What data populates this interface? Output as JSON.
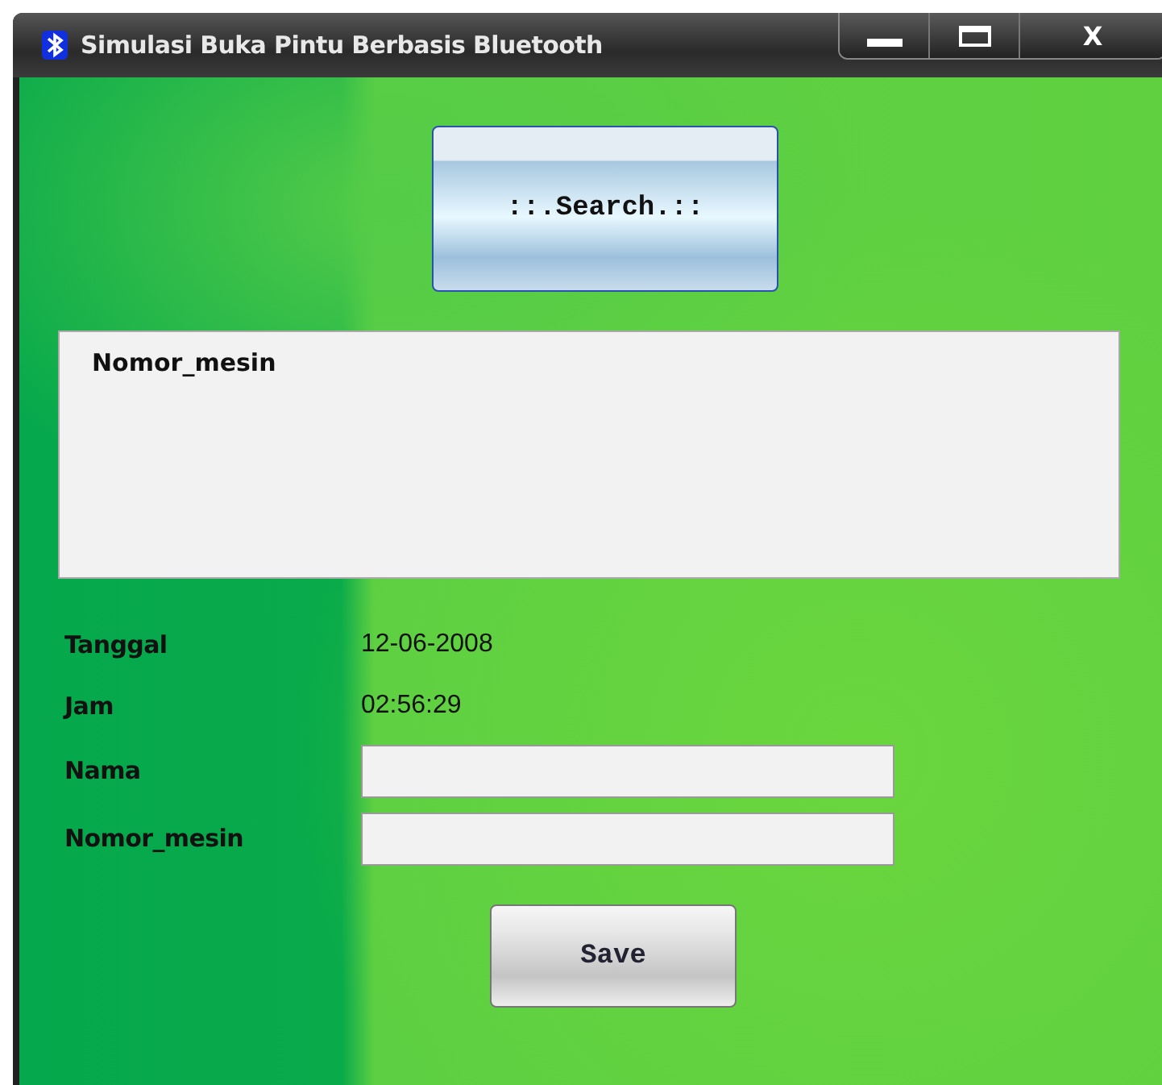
{
  "window": {
    "title": "Simulasi Buka Pintu Berbasis Bluetooth",
    "controls": [
      {
        "kind": "minimize"
      },
      {
        "kind": "maximize"
      },
      {
        "kind": "close",
        "label": "X"
      }
    ]
  },
  "search_button": {
    "label": "::.Search.::"
  },
  "list": {
    "items": [
      "Nomor_mesin"
    ]
  },
  "fields": [
    {
      "kind": "text",
      "label": "Tanggal",
      "value": "12-06-2008"
    },
    {
      "kind": "text",
      "label": "Jam",
      "value": "02:56:29"
    },
    {
      "kind": "input",
      "label": "Nama"
    },
    {
      "kind": "input",
      "label": "Nomor_mesin"
    }
  ],
  "save_button": {
    "label": "Save"
  }
}
